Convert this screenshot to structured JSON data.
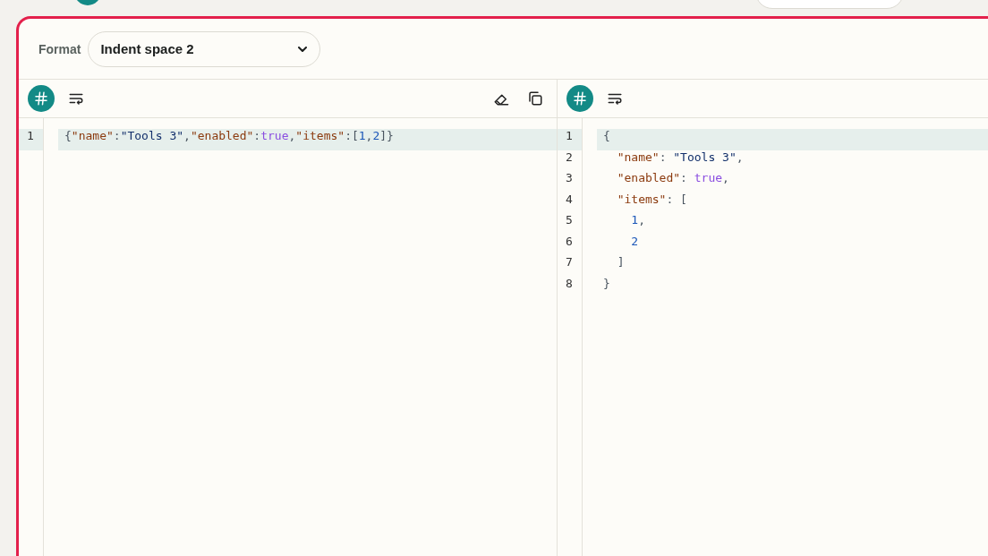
{
  "format": {
    "label": "Format",
    "value": "Indent space 2"
  },
  "panes": [
    {
      "tools": [
        {
          "kind": "hash"
        },
        {
          "kind": "wrap"
        },
        {
          "kind": "clear"
        },
        {
          "kind": "copy"
        }
      ],
      "lines": [
        {
          "number": "1",
          "active": true,
          "tokens": [
            {
              "kind": "punct",
              "text": "{"
            },
            {
              "kind": "key",
              "text": "\"name\""
            },
            {
              "kind": "punct",
              "text": ":"
            },
            {
              "kind": "string",
              "text": "\"Tools 3\""
            },
            {
              "kind": "punct",
              "text": ","
            },
            {
              "kind": "key",
              "text": "\"enabled\""
            },
            {
              "kind": "punct",
              "text": ":"
            },
            {
              "kind": "bool",
              "text": "true"
            },
            {
              "kind": "punct",
              "text": ","
            },
            {
              "kind": "key",
              "text": "\"items\""
            },
            {
              "kind": "punct",
              "text": ":["
            },
            {
              "kind": "number",
              "text": "1"
            },
            {
              "kind": "punct",
              "text": ","
            },
            {
              "kind": "number",
              "text": "2"
            },
            {
              "kind": "punct",
              "text": "]}"
            }
          ]
        }
      ]
    },
    {
      "tools": [
        {
          "kind": "hash"
        },
        {
          "kind": "wrap"
        }
      ],
      "lines": [
        {
          "number": "1",
          "active": true,
          "tokens": [
            {
              "kind": "punct",
              "text": "{"
            }
          ]
        },
        {
          "number": "2",
          "active": false,
          "tokens": [
            {
              "kind": "key",
              "text": "  \"name\""
            },
            {
              "kind": "punct",
              "text": ": "
            },
            {
              "kind": "string",
              "text": "\"Tools 3\""
            },
            {
              "kind": "punct",
              "text": ","
            }
          ]
        },
        {
          "number": "3",
          "active": false,
          "tokens": [
            {
              "kind": "key",
              "text": "  \"enabled\""
            },
            {
              "kind": "punct",
              "text": ": "
            },
            {
              "kind": "bool",
              "text": "true"
            },
            {
              "kind": "punct",
              "text": ","
            }
          ]
        },
        {
          "number": "4",
          "active": false,
          "tokens": [
            {
              "kind": "key",
              "text": "  \"items\""
            },
            {
              "kind": "punct",
              "text": ": ["
            }
          ]
        },
        {
          "number": "5",
          "active": false,
          "tokens": [
            {
              "kind": "number",
              "text": "    1"
            },
            {
              "kind": "punct",
              "text": ","
            }
          ]
        },
        {
          "number": "6",
          "active": false,
          "tokens": [
            {
              "kind": "number",
              "text": "    2"
            }
          ]
        },
        {
          "number": "7",
          "active": false,
          "tokens": [
            {
              "kind": "punct",
              "text": "  ]"
            }
          ]
        },
        {
          "number": "8",
          "active": false,
          "tokens": [
            {
              "kind": "punct",
              "text": "}"
            }
          ]
        }
      ]
    }
  ]
}
